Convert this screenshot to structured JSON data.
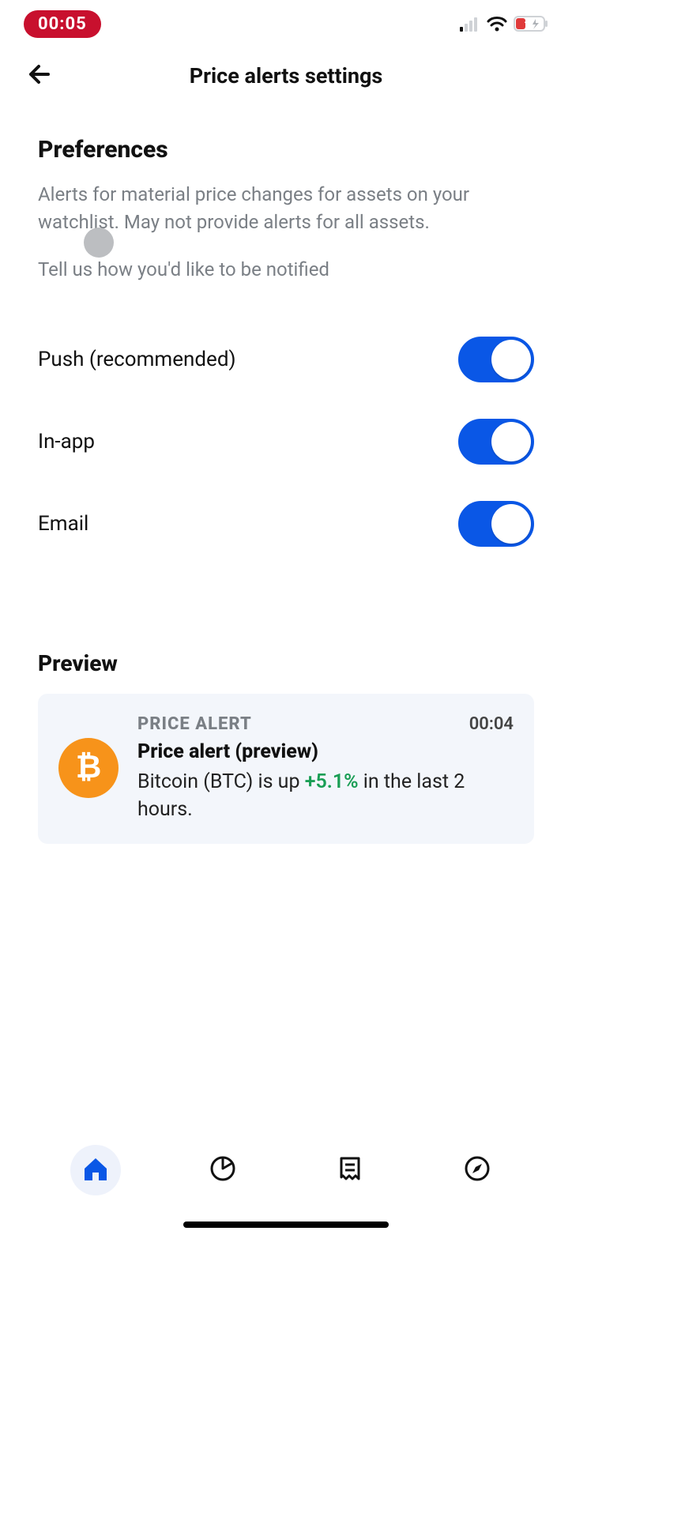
{
  "status": {
    "time": "00:05",
    "battery": "13"
  },
  "header": {
    "title": "Price alerts settings"
  },
  "preferences": {
    "title": "Preferences",
    "description": "Alerts for material price changes for assets on your watchlist. May not provide alerts for all assets.",
    "subdescription": "Tell us how you'd like to be notified",
    "items": [
      {
        "label": "Push (recommended)",
        "on": true
      },
      {
        "label": "In-app",
        "on": true
      },
      {
        "label": "Email",
        "on": true
      }
    ]
  },
  "preview": {
    "title": "Preview",
    "tag": "PRICE ALERT",
    "time": "00:04",
    "heading": "Price alert (preview)",
    "text_prefix": "Bitcoin (BTC) is up ",
    "pct": "+5.1%",
    "text_suffix": " in the last 2 hours.",
    "asset_symbol": "₿"
  }
}
